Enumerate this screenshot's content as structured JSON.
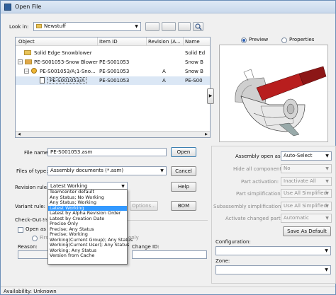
{
  "window": {
    "title": "Open File"
  },
  "look_in": {
    "label": "Look in:",
    "value": "Newstuff"
  },
  "file_list": {
    "columns": [
      "Object",
      "Item ID",
      "Revision (A...",
      "Name"
    ],
    "rows": [
      {
        "object": "Solid Edge Snowblower",
        "item_id": "",
        "revision": "",
        "name": "Solid Ed"
      },
      {
        "object": "PE-S001053-Snow Blower",
        "item_id": "PE-S001053",
        "revision": "",
        "name": "Snow B"
      },
      {
        "object": "PE-S001053/A;1-Sno...",
        "item_id": "PE-S001053",
        "revision": "A",
        "name": "Snow B"
      },
      {
        "object": "PE-S001053/A",
        "item_id": "PE-S001053",
        "revision": "A",
        "name": "PE-S00"
      }
    ]
  },
  "preview": {
    "preview_label": "Preview",
    "properties_label": "Properties",
    "selected": "Preview"
  },
  "file_name": {
    "label": "File name:",
    "value": "PE-S001053.asm"
  },
  "files_of_type": {
    "label": "Files of type:",
    "value": "Assembly documents (*.asm)"
  },
  "revision_rule": {
    "label": "Revision rule:",
    "value": "Latest Working",
    "options": [
      "Teamcenter default",
      "Any Status; No Working",
      "Any Status; Working",
      "Latest Working",
      "Latest by Alpha Revision Order",
      "Latest by Creation Date",
      "Precise Only",
      "Precise; Any Status",
      "Precise; Working",
      "Working(Current Group); Any Status",
      "Working(Current User); Any Status",
      "Working; Any Status",
      "Version from Cache"
    ],
    "highlighted": "Latest Working"
  },
  "variant_rule": {
    "label": "Variant rule:"
  },
  "checkout": {
    "label": "Check-Out Inf",
    "open_as_label": "Open as re",
    "first_label": "First",
    "only_label": "only",
    "reason_label": "Reason:",
    "change_id_label": "Change ID:"
  },
  "buttons": {
    "open": "Open",
    "cancel": "Cancel",
    "help": "Help",
    "options": "Options...",
    "bom": "BOM",
    "save_as_default": "Save As Default"
  },
  "assembly": {
    "open_as_label": "Assembly open as:",
    "open_as_value": "Auto-Select",
    "hide_label": "Hide all components:",
    "hide_value": "No",
    "part_activation_label": "Part activation:",
    "part_activation_value": "Inactivate All",
    "part_simplification_label": "Part simplification:",
    "part_simplification_value": "Use All Simplified",
    "subassembly_label": "Subassembly simplification:",
    "subassembly_value": "Use All Simplified",
    "activate_changed_label": "Activate changed parts:",
    "activate_changed_value": "Automatic",
    "configuration_label": "Configuration:",
    "zone_label": "Zone:"
  },
  "status": {
    "text": "Availability: Unknown"
  },
  "colors": {
    "highlight": "#3399ff",
    "selection": "#dbe7f5",
    "accent": "#3c7fb1"
  }
}
